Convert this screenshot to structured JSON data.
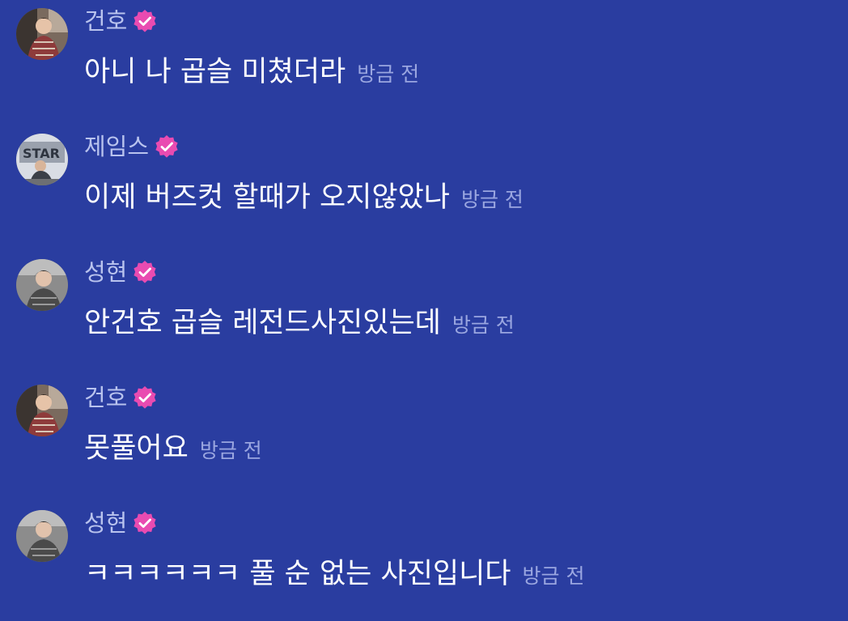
{
  "colors": {
    "background": "#2a3da0",
    "author_name": "#b9c3ee",
    "message_text": "#ffffff",
    "timestamp": "#9aa6e0",
    "verified_badge": "#e94bb1"
  },
  "messages": [
    {
      "author": "건호",
      "verified": true,
      "avatar_icon": "person-photo-avatar",
      "text": "아니 나 곱슬 미쳤더라",
      "time": "방금 전"
    },
    {
      "author": "제임스",
      "verified": true,
      "avatar_icon": "person-photo-avatar",
      "text": "이제 버즈컷 할때가 오지않았나",
      "time": "방금 전"
    },
    {
      "author": "성현",
      "verified": true,
      "avatar_icon": "person-photo-avatar",
      "text": "안건호 곱슬 레전드사진있는데",
      "time": "방금 전"
    },
    {
      "author": "건호",
      "verified": true,
      "avatar_icon": "person-photo-avatar",
      "text": "못풀어요",
      "time": "방금 전"
    },
    {
      "author": "성현",
      "verified": true,
      "avatar_icon": "person-photo-avatar",
      "text": "ㅋㅋㅋㅋㅋㅋ 풀 순 없는 사진입니다",
      "time": "방금 전"
    }
  ]
}
